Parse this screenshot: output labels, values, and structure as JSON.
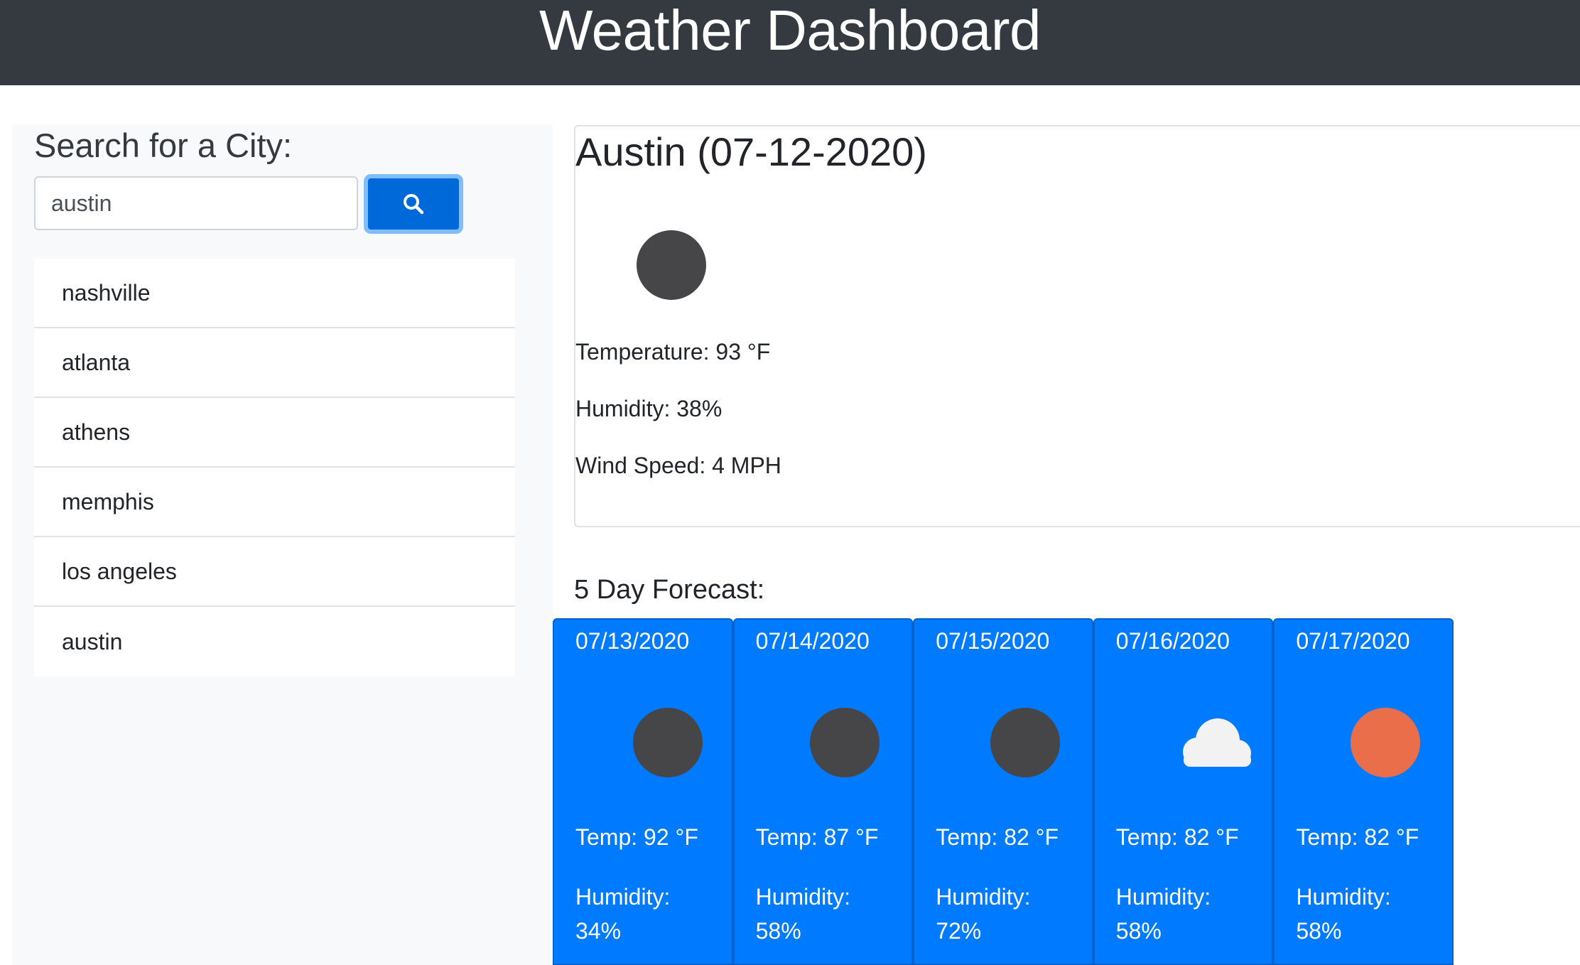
{
  "header": {
    "title": "Weather Dashboard"
  },
  "sidebar": {
    "heading": "Search for a City:",
    "search_value": "austin",
    "search_icon": "search-icon",
    "history": [
      "nashville",
      "atlanta",
      "athens",
      "memphis",
      "los angeles",
      "austin"
    ]
  },
  "current": {
    "title": "Austin (07-12-2020)",
    "icon": "moon-clear-icon",
    "temperature": "Temperature: 93 °F",
    "humidity": "Humidity: 38%",
    "wind": "Wind Speed: 4 MPH"
  },
  "forecast": {
    "title": "5 Day Forecast:",
    "days": [
      {
        "date": "07/13/2020",
        "icon": "moon-clear-icon",
        "temp": "Temp: 92 °F",
        "humidity_label": "Humidity:",
        "humidity_value": "34%"
      },
      {
        "date": "07/14/2020",
        "icon": "moon-clear-icon",
        "temp": "Temp: 87 °F",
        "humidity_label": "Humidity:",
        "humidity_value": "58%"
      },
      {
        "date": "07/15/2020",
        "icon": "moon-clear-icon",
        "temp": "Temp: 82 °F",
        "humidity_label": "Humidity:",
        "humidity_value": "72%"
      },
      {
        "date": "07/16/2020",
        "icon": "cloud-icon",
        "temp": "Temp: 82 °F",
        "humidity_label": "Humidity:",
        "humidity_value": "58%"
      },
      {
        "date": "07/17/2020",
        "icon": "sun-icon",
        "temp": "Temp: 82 °F",
        "humidity_label": "Humidity:",
        "humidity_value": "58%"
      }
    ]
  },
  "colors": {
    "header_bg": "#343a40",
    "primary": "#007bff",
    "moon": "#464648",
    "sun": "#eb6e4b",
    "cloud": "#f2f2f2"
  }
}
